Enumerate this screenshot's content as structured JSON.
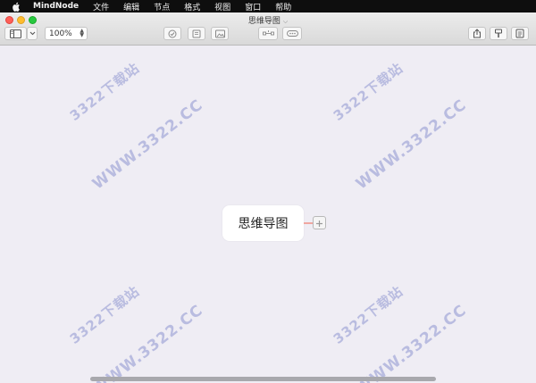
{
  "menubar": {
    "app_name": "MindNode",
    "items": [
      "文件",
      "编辑",
      "节点",
      "格式",
      "视图",
      "窗口",
      "帮助"
    ]
  },
  "window": {
    "title": "思维导图",
    "zoom_value": "100%"
  },
  "canvas": {
    "root_node_text": "思维导图",
    "watermarks": [
      "3322下载站",
      "WWW.3322.CC"
    ]
  },
  "icons": {
    "apple": "apple-logo-icon",
    "sidebar": "sidebar-toggle-icon",
    "chevron": "chevron-down-icon",
    "complete": "task-check-icon",
    "note": "note-icon",
    "image": "image-icon",
    "connect": "connection-icon",
    "more": "more-icon",
    "share": "share-icon",
    "format": "format-brush-icon",
    "outline": "outline-icon",
    "add": "plus-icon"
  }
}
